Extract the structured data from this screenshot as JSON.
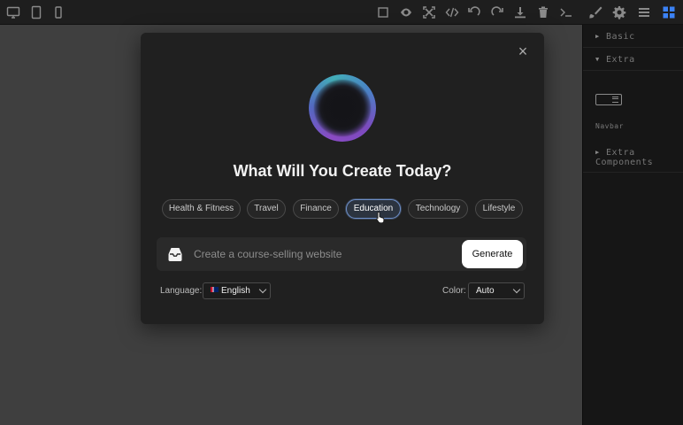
{
  "toolbar": {
    "left_icons": [
      "desktop-icon",
      "tablet-icon",
      "mobile-icon"
    ],
    "right_icons": [
      "square-icon",
      "eye-icon",
      "fullscreen-icon",
      "code-icon",
      "undo-icon",
      "redo-icon",
      "download-icon",
      "trash-icon",
      "terminal-icon",
      "brush-icon",
      "gear-icon",
      "menu-icon",
      "blocks-icon"
    ]
  },
  "panel": {
    "categories": [
      {
        "label": "Basic",
        "expanded": false
      },
      {
        "label": "Extra",
        "expanded": true
      },
      {
        "label": "Extra Components",
        "expanded": false
      }
    ],
    "blocks": [
      {
        "label": "Navbar",
        "icon": "navbar-icon"
      }
    ]
  },
  "modal": {
    "close_label": "×",
    "heading": "What Will You Create Today?",
    "chips": [
      {
        "label": "Health & Fitness",
        "active": false
      },
      {
        "label": "Travel",
        "active": false
      },
      {
        "label": "Finance",
        "active": false
      },
      {
        "label": "Education",
        "active": true
      },
      {
        "label": "Technology",
        "active": false
      },
      {
        "label": "Lifestyle",
        "active": false
      }
    ],
    "prompt_placeholder": "Create a course-selling website",
    "generate_label": "Generate",
    "language_label": "Language:",
    "language_value": "English",
    "color_label": "Color:",
    "color_value": "Auto"
  },
  "colors": {
    "accent": "#3b82f6",
    "chip_active_border": "#6d8ec7",
    "modal_bg": "#202020"
  }
}
